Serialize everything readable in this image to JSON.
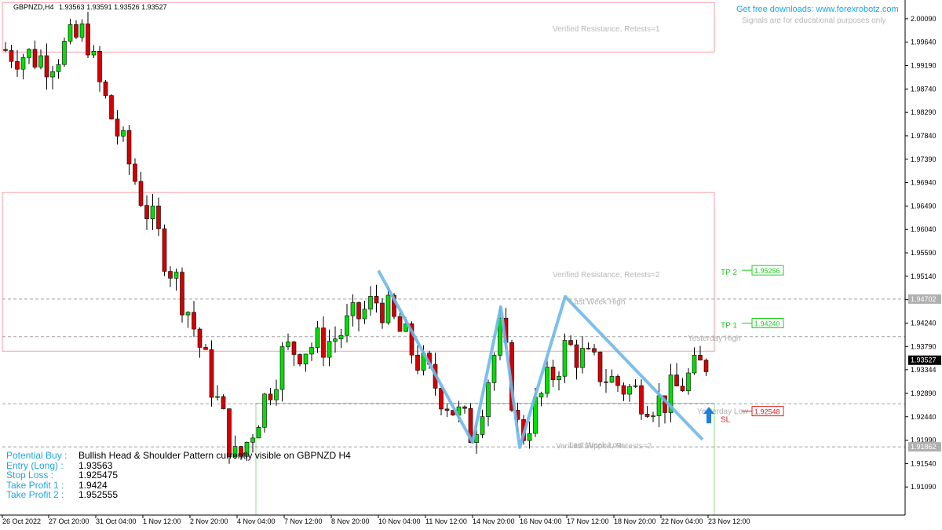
{
  "header": {
    "symbol": "GBPNZD,H4",
    "ohlc": "1.93563 1.93591 1.93526 1.93527",
    "promo": "Get free downloads: www.forexrobotz.com",
    "disclaimer": "Signals are for educational purposes only"
  },
  "colors": {
    "bull": "#00e000",
    "bear": "#d40000",
    "pattern": "#6fb8ea",
    "zone": "#f4a0a8",
    "support_zone": "#8fd88f",
    "info_key": "#1ea7e1",
    "tp": "#22cc22",
    "sl": "#e02020",
    "arrow": "#1e7fe0"
  },
  "info_panel": [
    {
      "key": "Potential Buy :",
      "value": "Bullish Head & Shoulder Pattern currently visible on GBPNZD H4"
    },
    {
      "key": "Entry (Long) :",
      "value": "1.93563"
    },
    {
      "key": "Stop Loss :",
      "value": "1.925475"
    },
    {
      "key": "Take Profit 1 :",
      "value": "1.9424"
    },
    {
      "key": "Take Profit 2 :",
      "value": "1.952555"
    }
  ],
  "chart_data": {
    "type": "candlestick",
    "symbol": "GBPNZD",
    "timeframe": "H4",
    "ylim": [
      1.9055,
      2.0042
    ],
    "y_ticks": [
      "2.00090",
      "1.99640",
      "1.99190",
      "1.98740",
      "1.98290",
      "1.97840",
      "1.97390",
      "1.96940",
      "1.96490",
      "1.96040",
      "1.95590",
      "1.95140",
      "1.94690",
      "1.94240",
      "1.93790",
      "1.93344",
      "1.92890",
      "1.92440",
      "1.91990",
      "1.91540",
      "1.91090"
    ],
    "x_labels": [
      "26 Oct 2022",
      "27 Oct 20:00",
      "31 Oct 04:00",
      "1 Nov 12:00",
      "2 Nov 20:00",
      "4 Nov 04:00",
      "7 Nov 12:00",
      "8 Nov 20:00",
      "10 Nov 04:00",
      "11 Nov 12:00",
      "14 Nov 20:00",
      "16 Nov 04:00",
      "17 Nov 12:00",
      "18 Nov 20:00",
      "22 Nov 04:00",
      "23 Nov 12:00"
    ],
    "key_points": [
      {
        "x": "26 Oct 2022",
        "close": 1.995
      },
      {
        "x": "27 Oct 20:00",
        "close": 1.993
      },
      {
        "x": "28 Oct 12:00",
        "close": 1.9985
      },
      {
        "x": "31 Oct 04:00",
        "close": 1.99
      },
      {
        "x": "1 Nov 12:00",
        "close": 1.966
      },
      {
        "x": "2 Nov 20:00",
        "close": 1.944
      },
      {
        "x": "4 Nov 04:00",
        "close": 1.915
      },
      {
        "x": "7 Nov 12:00",
        "close": 1.937
      },
      {
        "x": "8 Nov 20:00",
        "close": 1.939
      },
      {
        "x": "10 Nov 04:00",
        "close": 1.947
      },
      {
        "x": "11 Nov 12:00",
        "close": 1.933
      },
      {
        "x": "14 Nov 20:00",
        "close": 1.921
      },
      {
        "x": "15 Nov 12:00",
        "close": 1.941
      },
      {
        "x": "16 Nov 04:00",
        "close": 1.92
      },
      {
        "x": "17 Nov 12:00",
        "close": 1.938
      },
      {
        "x": "18 Nov 20:00",
        "close": 1.931
      },
      {
        "x": "22 Nov 04:00",
        "close": 1.927
      },
      {
        "x": "23 Nov 12:00",
        "close": 1.9353
      }
    ],
    "levels": {
      "last_price": "1.93527",
      "last_week_high": "1.94702",
      "last_week_low": "1.91862",
      "tp2": "1.95256",
      "tp1": "1.94240",
      "sl": "1.92548"
    },
    "level_labels": {
      "tp2": "TP 2",
      "tp1": "TP 1",
      "sl": "SL",
      "last_week_high": "Last Week High",
      "last_week_low": "Last Week Low",
      "yesterday_high": "Yesterday High",
      "yesterday_low": "Yesterday Low"
    },
    "zones": [
      {
        "label": "Verified Resistance, Retests=1",
        "from": 1.9945,
        "to": 2.004
      },
      {
        "label": "Verified Resistance, Retests=2",
        "from": 1.937,
        "to": 1.9675
      },
      {
        "label": "Verified Support, Retests=2",
        "from": 1.9055,
        "to": 1.927
      }
    ],
    "pattern": {
      "name": "Bullish Head & Shoulder",
      "points": [
        {
          "x": "10 Nov 04:00",
          "y": 1.9525
        },
        {
          "x": "14 Nov 20:00",
          "y": 1.9195
        },
        {
          "x": "15 Nov 12:00",
          "y": 1.9455
        },
        {
          "x": "16 Nov 04:00",
          "y": 1.9185
        },
        {
          "x": "17 Nov 04:00",
          "y": 1.9475
        },
        {
          "x": "22 Nov 12:00",
          "y": 1.92
        }
      ]
    }
  }
}
